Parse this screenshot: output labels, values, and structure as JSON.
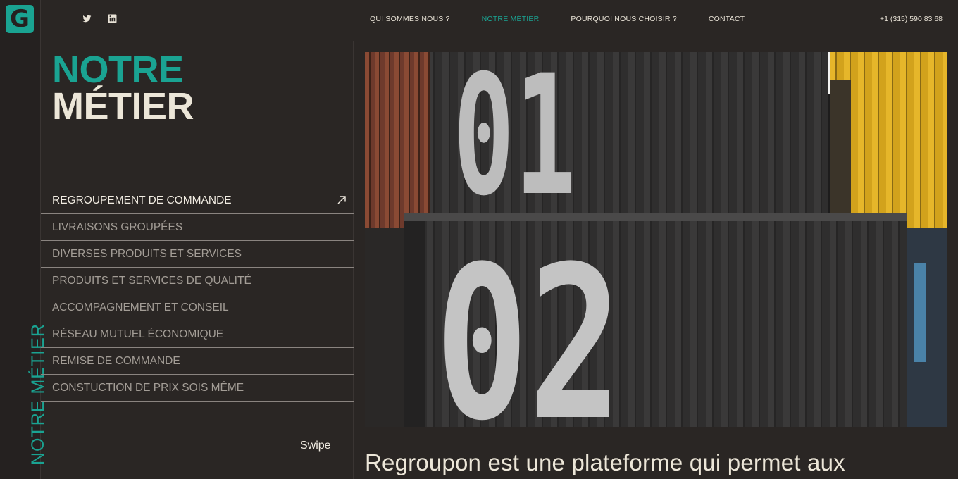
{
  "brand": {
    "logo_letter": "G"
  },
  "colors": {
    "accent": "#1aa392",
    "background": "#2a2624",
    "text": "#e8e2d6"
  },
  "social": [
    {
      "icon": "twitter-icon"
    },
    {
      "icon": "linkedin-icon"
    }
  ],
  "nav": {
    "items": [
      {
        "label": "QUI SOMMES NOUS ?",
        "active": false
      },
      {
        "label": "NOTRE MÉTIER",
        "active": true
      },
      {
        "label": "POURQUOI NOUS CHOISIR ?",
        "active": false
      },
      {
        "label": "CONTACT",
        "active": false
      }
    ],
    "phone": "+1 (315) 590 83 68"
  },
  "sidebar": {
    "vertical_label": "NOTRE MÉTIER"
  },
  "page": {
    "title_line1": "NOTRE",
    "title_line2": "MÉTIER",
    "swipe_label": "Swipe",
    "tagline": "Regroupon est une plateforme qui permet aux"
  },
  "menu": {
    "items": [
      {
        "label": "REGROUPEMENT DE COMMANDE",
        "active": true
      },
      {
        "label": "LIVRAISONS GROUPÉES",
        "active": false
      },
      {
        "label": "DIVERSES PRODUITS ET SERVICES",
        "active": false
      },
      {
        "label": "PRODUITS ET SERVICES DE QUALITÉ",
        "active": false
      },
      {
        "label": "ACCOMPAGNEMENT ET CONSEIL",
        "active": false
      },
      {
        "label": "RÉSEAU MUTUEL ÉCONOMIQUE",
        "active": false
      },
      {
        "label": "REMISE DE COMMANDE",
        "active": false
      },
      {
        "label": "CONSTUCTION DE PRIX SOIS MÊME",
        "active": false
      }
    ]
  },
  "hero": {
    "upper_number": "01",
    "lower_number": "02"
  }
}
